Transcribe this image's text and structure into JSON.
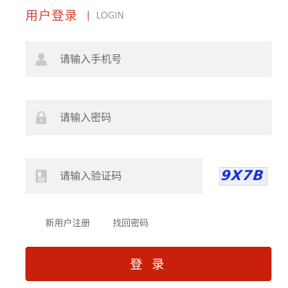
{
  "header": {
    "title": "用户登录",
    "separator": "|",
    "subtitle": "LOGIN"
  },
  "form": {
    "phone": {
      "placeholder": "请输入手机号",
      "icon": "user-icon"
    },
    "password": {
      "placeholder": "请输入密码",
      "icon": "lock-icon"
    },
    "captcha": {
      "placeholder": "请输入验证码",
      "icon": "captcha-card-icon",
      "image_text": "9X7B"
    }
  },
  "links": {
    "register": "新用户注册",
    "forgot_password": "找回密码"
  },
  "login_button": {
    "label": "登 录"
  },
  "colors": {
    "accent": "#d23c2c",
    "button": "#c9200c",
    "field_bg": "#f2f2f2",
    "icon": "#c8c8c8",
    "captcha_text": "#1c2fd6"
  }
}
